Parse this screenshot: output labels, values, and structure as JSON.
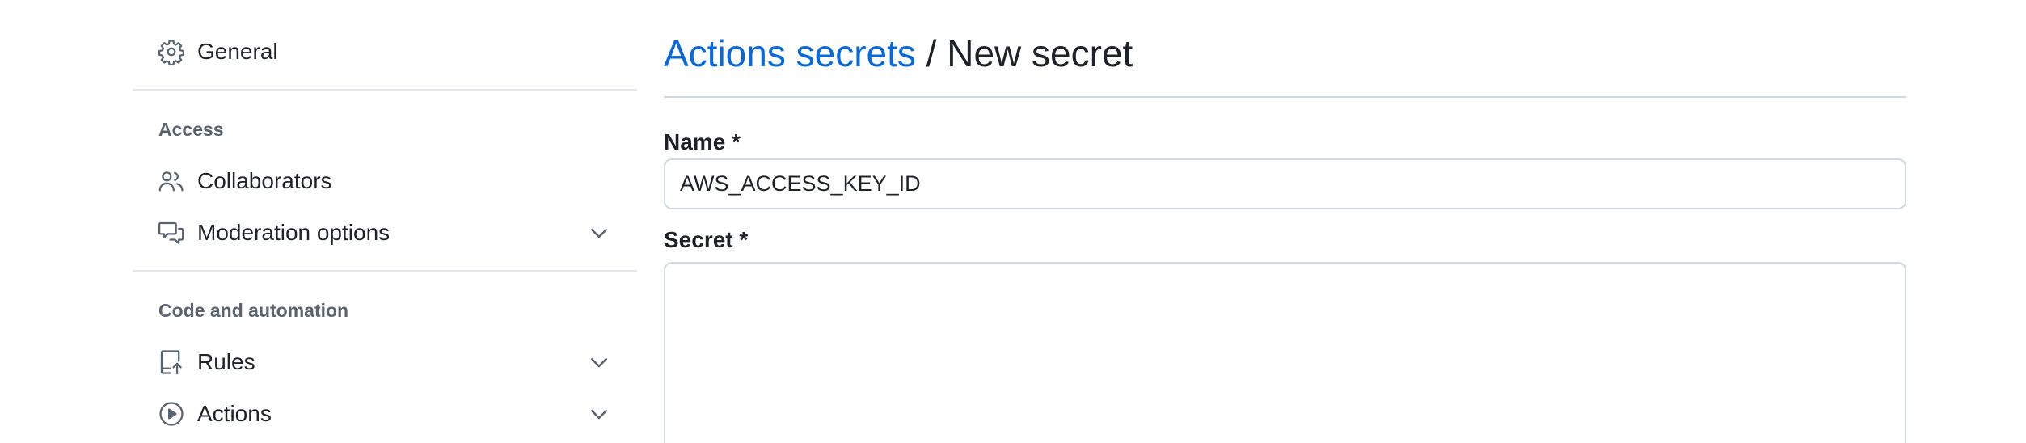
{
  "sidebar": {
    "general": {
      "label": "General",
      "icon": "gear-icon"
    },
    "sections": [
      {
        "heading": "Access",
        "items": [
          {
            "label": "Collaborators",
            "icon": "people-icon",
            "expandable": false
          },
          {
            "label": "Moderation options",
            "icon": "comment-discussion-icon",
            "expandable": true
          }
        ]
      },
      {
        "heading": "Code and automation",
        "items": [
          {
            "label": "Rules",
            "icon": "repo-push-icon",
            "expandable": true
          },
          {
            "label": "Actions",
            "icon": "play-icon",
            "expandable": true
          }
        ]
      }
    ]
  },
  "main": {
    "breadcrumb_link": "Actions secrets",
    "breadcrumb_separator": " / ",
    "title": "New secret",
    "name_label": "Name *",
    "name_value": "AWS_ACCESS_KEY_ID",
    "secret_label": "Secret *",
    "secret_value": ""
  },
  "colors": {
    "link": "#0969da",
    "text": "#1f2328",
    "muted": "#59636e",
    "border": "#d1d9e0"
  }
}
